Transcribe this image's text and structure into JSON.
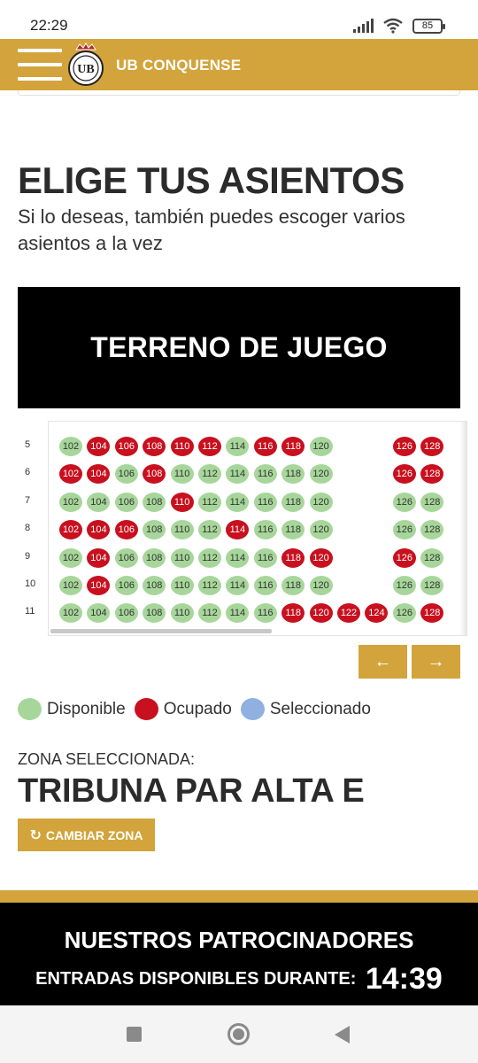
{
  "status_bar": {
    "time": "22:29",
    "battery": "85"
  },
  "header": {
    "title": "UB CONQUENSE",
    "crest_text": "UB"
  },
  "heading": {
    "title": "ELIGE TUS ASIENTOS",
    "subtitle": "Si lo deseas, también puedes escoger varios asientos a la vez"
  },
  "field": {
    "label": "TERRENO DE JUEGO"
  },
  "seat_map": {
    "columns": [
      "102",
      "104",
      "106",
      "108",
      "110",
      "112",
      "114",
      "116",
      "118",
      "120",
      "122",
      "124",
      "126",
      "128"
    ],
    "rows": [
      {
        "label": "5",
        "seats": {
          "102": "available",
          "104": "occupied",
          "106": "occupied",
          "108": "occupied",
          "110": "occupied",
          "112": "occupied",
          "114": "available",
          "116": "occupied",
          "118": "occupied",
          "120": "available",
          "126": "occupied",
          "128": "occupied"
        }
      },
      {
        "label": "6",
        "seats": {
          "102": "occupied",
          "104": "occupied",
          "106": "available",
          "108": "occupied",
          "110": "available",
          "112": "available",
          "114": "available",
          "116": "available",
          "118": "available",
          "120": "available",
          "126": "occupied",
          "128": "occupied"
        }
      },
      {
        "label": "7",
        "seats": {
          "102": "available",
          "104": "available",
          "106": "available",
          "108": "available",
          "110": "occupied",
          "112": "available",
          "114": "available",
          "116": "available",
          "118": "available",
          "120": "available",
          "126": "available",
          "128": "available"
        }
      },
      {
        "label": "8",
        "seats": {
          "102": "occupied",
          "104": "occupied",
          "106": "occupied",
          "108": "available",
          "110": "available",
          "112": "available",
          "114": "occupied",
          "116": "available",
          "118": "available",
          "120": "available",
          "126": "available",
          "128": "available"
        }
      },
      {
        "label": "9",
        "seats": {
          "102": "available",
          "104": "occupied",
          "106": "available",
          "108": "available",
          "110": "available",
          "112": "available",
          "114": "available",
          "116": "available",
          "118": "occupied",
          "120": "occupied",
          "126": "occupied",
          "128": "available"
        }
      },
      {
        "label": "10",
        "seats": {
          "102": "available",
          "104": "occupied",
          "106": "available",
          "108": "available",
          "110": "available",
          "112": "available",
          "114": "available",
          "116": "available",
          "118": "available",
          "120": "available",
          "126": "available",
          "128": "available"
        }
      },
      {
        "label": "11",
        "seats": {
          "102": "available",
          "104": "available",
          "106": "available",
          "108": "available",
          "110": "available",
          "112": "available",
          "114": "available",
          "116": "available",
          "118": "occupied",
          "120": "occupied",
          "122": "occupied",
          "124": "occupied",
          "126": "available",
          "128": "occupied"
        }
      }
    ],
    "prev_label": "←",
    "next_label": "→"
  },
  "colors": {
    "brand": "#d2a43b",
    "available": "#a7d69a",
    "occupied": "#c8101e",
    "selected": "#8fb0e0"
  },
  "legend": [
    {
      "key": "available",
      "label": "Disponible"
    },
    {
      "key": "occupied",
      "label": "Ocupado"
    },
    {
      "key": "selected",
      "label": "Seleccionado"
    }
  ],
  "zone": {
    "label": "ZONA SELECCIONADA:",
    "value": "TRIBUNA PAR ALTA E",
    "change_button": "CAMBIAR ZONA",
    "change_icon": "refresh-icon"
  },
  "footer": {
    "sponsors_title": "NUESTROS PATROCINADORES",
    "countdown_label": "ENTRADAS DISPONIBLES DURANTE:",
    "countdown_time": "14:39"
  }
}
